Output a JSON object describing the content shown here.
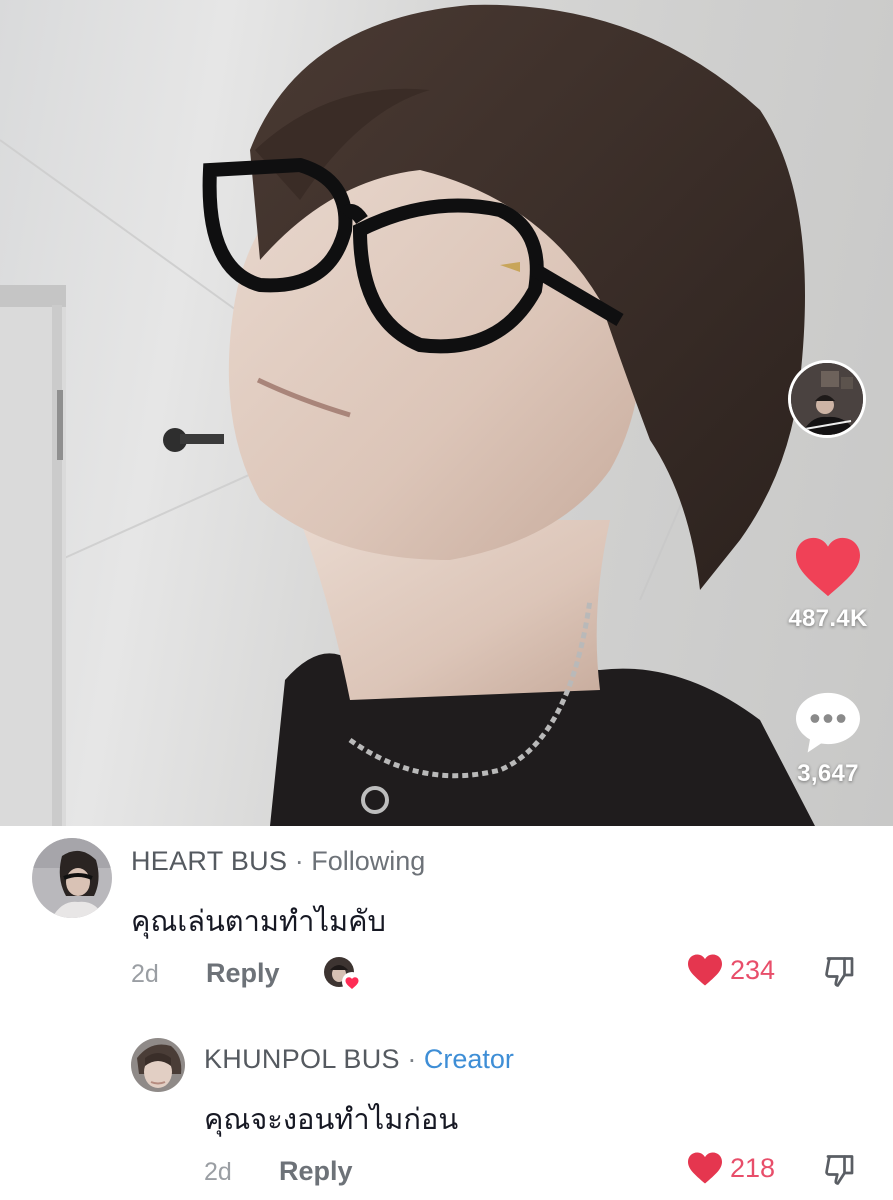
{
  "video": {
    "likes": "487.4K",
    "comments": "3,647"
  },
  "comments": [
    {
      "author": "HEART BUS",
      "relation": "Following",
      "text": "คุณเล่นตามทำไมคับ",
      "age": "2d",
      "reply_label": "Reply",
      "likes": "234",
      "creator_liked": true
    },
    {
      "author": "KHUNPOL BUS",
      "relation": "Creator",
      "text": "คุณจะงอนทำไมก่อน",
      "age": "2d",
      "reply_label": "Reply",
      "likes": "218"
    }
  ],
  "colors": {
    "like_red": "#fe2c55",
    "creator_blue": "#3e8ed6",
    "meta_gray": "#9a9ea3"
  },
  "icons": [
    "heart-icon",
    "comment-bubble-icon",
    "dislike-icon",
    "creator-liked-icon"
  ]
}
